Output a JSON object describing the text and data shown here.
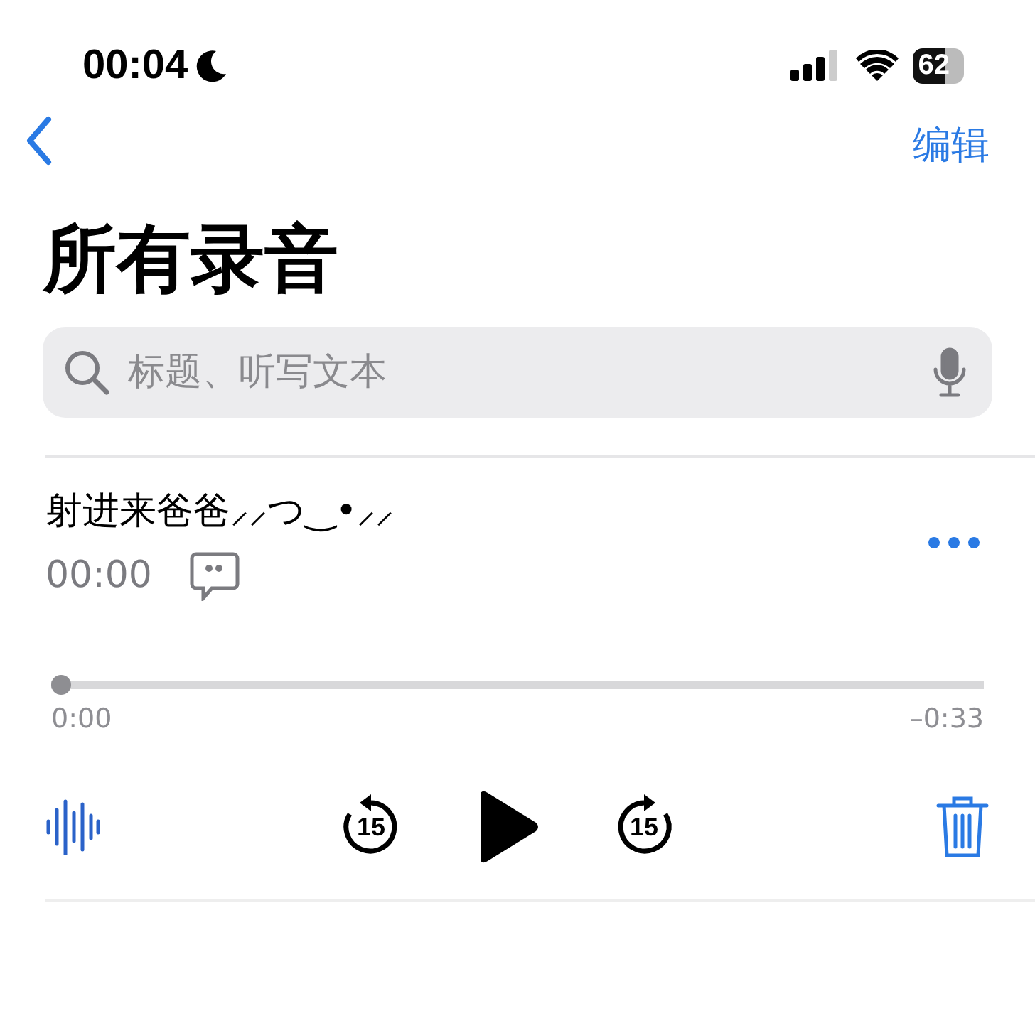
{
  "status_bar": {
    "time": "00:04",
    "do_not_disturb": true,
    "battery": "62"
  },
  "nav": {
    "back": true,
    "edit": "编辑"
  },
  "title": "所有录音",
  "search": {
    "placeholder": "标题、听写文本"
  },
  "recording": {
    "title": "射进来爸爸⸝⸝つ‿•⸝⸝",
    "duration": "00:00",
    "transcript": true,
    "level": 0,
    "elapsed": "0:00",
    "remaining": "–0:33",
    "skip_back": "15",
    "skip_forward": "15"
  }
}
